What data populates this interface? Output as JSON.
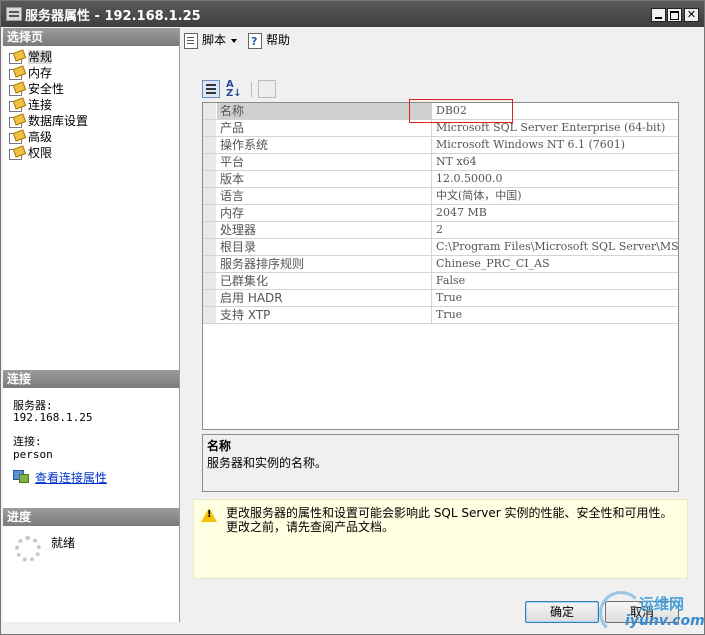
{
  "window": {
    "title": "服务器属性 - 192.168.1.25"
  },
  "left": {
    "select_page_header": "选择页",
    "nav": [
      "常规",
      "内存",
      "安全性",
      "连接",
      "数据库设置",
      "高级",
      "权限"
    ],
    "connection_header": "连接",
    "server_label": "服务器:",
    "server_value": "192.168.1.25",
    "connection_label": "连接:",
    "connection_value": "person",
    "view_link": "查看连接属性",
    "progress_header": "进度",
    "progress_status": "就绪"
  },
  "toolbar": {
    "script_label": "脚本",
    "help_label": "帮助"
  },
  "properties": [
    {
      "name": "名称",
      "value": "DB02"
    },
    {
      "name": "产品",
      "value": "Microsoft SQL Server Enterprise (64-bit)"
    },
    {
      "name": "操作系统",
      "value": "Microsoft Windows NT 6.1 (7601)"
    },
    {
      "name": "平台",
      "value": "NT x64"
    },
    {
      "name": "版本",
      "value": "12.0.5000.0"
    },
    {
      "name": "语言",
      "value": "中文(简体，中国)"
    },
    {
      "name": "内存",
      "value": "2047 MB"
    },
    {
      "name": "处理器",
      "value": "2"
    },
    {
      "name": "根目录",
      "value": "C:\\Program Files\\Microsoft SQL Server\\MSS"
    },
    {
      "name": "服务器排序规则",
      "value": "Chinese_PRC_CI_AS"
    },
    {
      "name": "已群集化",
      "value": "False"
    },
    {
      "name": "启用 HADR",
      "value": "True"
    },
    {
      "name": "支持 XTP",
      "value": "True"
    }
  ],
  "description": {
    "title": "名称",
    "text": "服务器和实例的名称。"
  },
  "warning": {
    "text": "更改服务器的属性和设置可能会影响此 SQL Server 实例的性能、安全性和可用性。更改之前，请先查阅产品文档。"
  },
  "buttons": {
    "ok": "确定",
    "cancel": "取消"
  },
  "watermark": {
    "line1": "运维网",
    "line2": "iyunv.com"
  },
  "colors": {
    "highlight_border": "#e02020",
    "warning_bg": "#ffffe1",
    "link": "#0033cc"
  }
}
